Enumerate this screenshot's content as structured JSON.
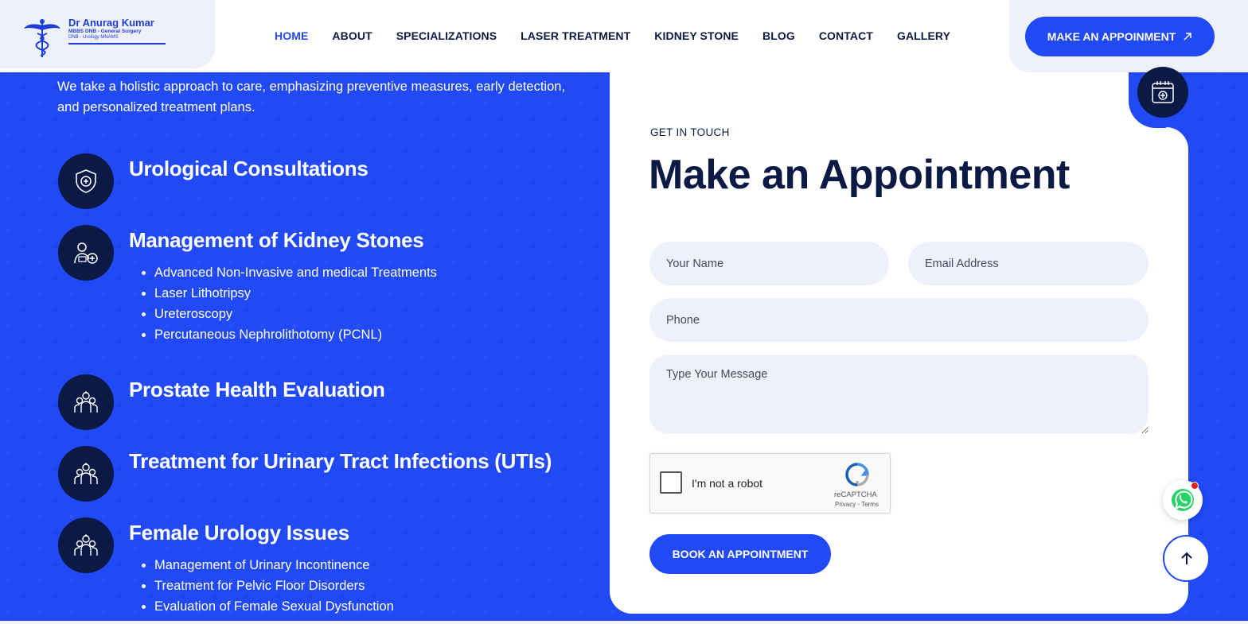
{
  "brand": {
    "name": "Dr Anurag Kumar",
    "line1": "MBBS DNB - General Surgery",
    "line2": "DNB - Urology MNAMS"
  },
  "nav": {
    "items": [
      {
        "label": "HOME",
        "active": true
      },
      {
        "label": "ABOUT"
      },
      {
        "label": "SPECIALIZATIONS"
      },
      {
        "label": "LASER TREATMENT"
      },
      {
        "label": "KIDNEY STONE"
      },
      {
        "label": "BLOG"
      },
      {
        "label": "CONTACT"
      },
      {
        "label": "GALLERY"
      }
    ],
    "cta_label": "MAKE AN APPOINMENT"
  },
  "intro": "We take a holistic approach to care, emphasizing preventive measures, early detection, and personalized treatment plans.",
  "services": [
    {
      "title": "Urological Consultations",
      "icon": "shield-medical-icon",
      "items": []
    },
    {
      "title": "Management of Kidney Stones",
      "icon": "doctor-patient-icon",
      "items": [
        "Advanced Non-Invasive and medical Treatments",
        "Laser Lithotripsy",
        "Ureteroscopy",
        "Percutaneous Nephrolithotomy (PCNL)"
      ]
    },
    {
      "title": "Prostate Health Evaluation",
      "icon": "medical-team-icon",
      "items": []
    },
    {
      "title": "Treatment for Urinary Tract Infections (UTIs)",
      "icon": "medical-team-icon",
      "items": []
    },
    {
      "title": "Female Urology Issues",
      "icon": "medical-team-icon",
      "items": [
        "Management of Urinary Incontinence",
        "Treatment for Pelvic Floor Disorders",
        "Evaluation of Female Sexual Dysfunction"
      ]
    }
  ],
  "form": {
    "kicker": "GET IN TOUCH",
    "title": "Make an Appointment",
    "name_placeholder": "Your Name",
    "email_placeholder": "Email Address",
    "phone_placeholder": "Phone",
    "message_placeholder": "Type Your Message",
    "captcha_label": "I'm not a robot",
    "captcha_brand": "reCAPTCHA",
    "captcha_links": "Privacy - Terms",
    "submit_label": "BOOK AN APPOINTMENT"
  },
  "colors": {
    "accent": "#2149f5",
    "navy": "#0b1a45",
    "field_bg": "#eef1fc",
    "notification": "#e8201d"
  }
}
